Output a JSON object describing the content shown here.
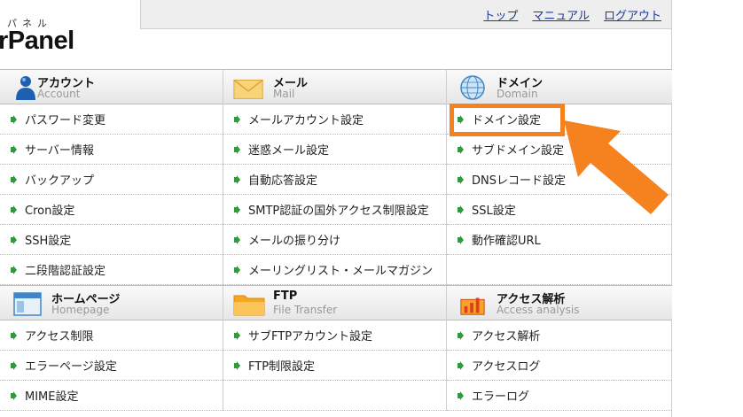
{
  "header": {
    "logo_sub": "パネル",
    "logo": "rPanel",
    "nav": [
      "トップ",
      "マニュアル",
      "ログアウト"
    ]
  },
  "groups": [
    {
      "columns": [
        {
          "title": "アカウント",
          "sub": "Account",
          "icon": "user-icon",
          "items": [
            "パスワード変更",
            "サーバー情報",
            "バックアップ",
            "Cron設定",
            "SSH設定",
            "二段階認証設定"
          ]
        },
        {
          "title": "メール",
          "sub": "Mail",
          "icon": "envelope-icon",
          "items": [
            "メールアカウント設定",
            "迷惑メール設定",
            "自動応答設定",
            "SMTP認証の国外アクセス制限設定",
            "メールの振り分け",
            "メーリングリスト・メールマガジン"
          ]
        },
        {
          "title": "ドメイン",
          "sub": "Domain",
          "icon": "globe-icon",
          "items": [
            "ドメイン設定",
            "サブドメイン設定",
            "DNSレコード設定",
            "SSL設定",
            "動作確認URL",
            ""
          ]
        }
      ]
    },
    {
      "columns": [
        {
          "title": "ホームページ",
          "sub": "Homepage",
          "icon": "browser-window-icon",
          "items": [
            "アクセス制限",
            "エラーページ設定",
            "MIME設定"
          ]
        },
        {
          "title": "FTP",
          "sub": "File Transfer",
          "icon": "folder-icon",
          "items": [
            "サブFTPアカウント設定",
            "FTP制限設定",
            ""
          ]
        },
        {
          "title": "アクセス解析",
          "sub": "Access analysis",
          "icon": "bar-chart-icon",
          "items": [
            "アクセス解析",
            "アクセスログ",
            "エラーログ"
          ]
        }
      ]
    }
  ],
  "colors": {
    "accent_orange": "#f5821f",
    "link_blue": "#1a3a9e",
    "arrow_green": "#2e9c3a"
  }
}
